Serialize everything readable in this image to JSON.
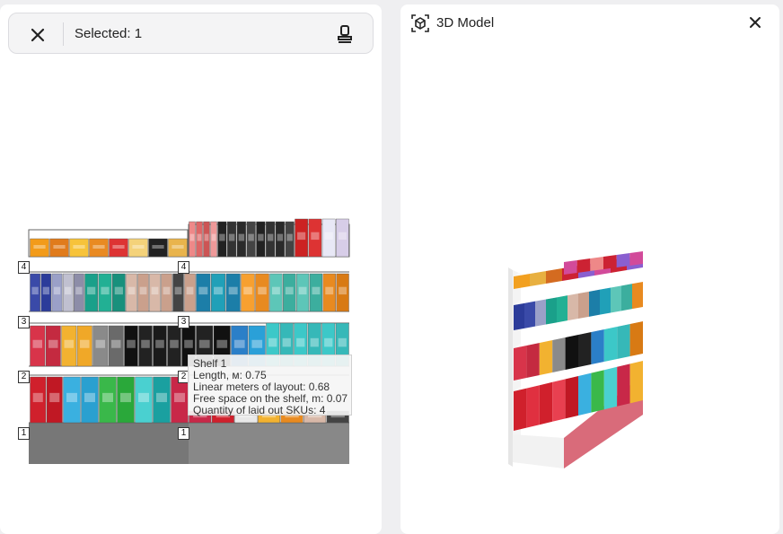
{
  "left_panel": {
    "toolbar": {
      "close_icon": "close-icon",
      "selected_label": "Selected: 1",
      "stamp_icon": "stamp-icon"
    },
    "shelf_numbers": {
      "left_column": [
        "4",
        "3",
        "2",
        "1"
      ],
      "right_column": [
        "4",
        "3",
        "2",
        "1"
      ]
    },
    "tooltip": {
      "title": "Shelf 1",
      "length": "Length, м: 0.75",
      "linear_meters": "Linear meters of layout: 0.68",
      "free_space": "Free space on the shelf, m: 0.07",
      "skus": "Quantity of laid out SKUs: 4"
    }
  },
  "right_panel": {
    "title": "3D Model",
    "cube_icon": "3d-cube-icon",
    "close_icon": "close-icon"
  }
}
